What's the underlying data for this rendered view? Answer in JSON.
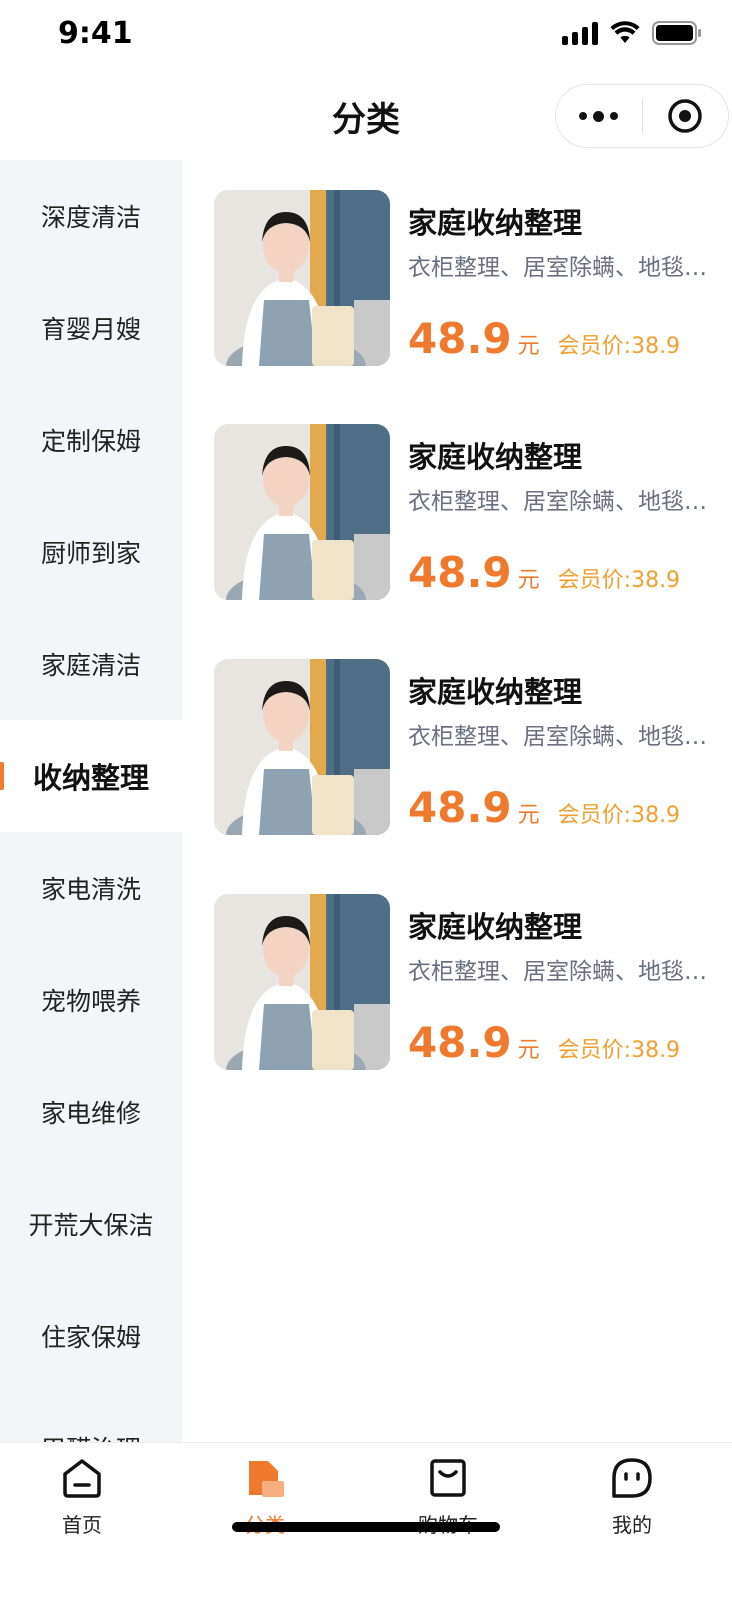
{
  "status_bar": {
    "time": "9:41"
  },
  "nav": {
    "title": "分类"
  },
  "sidebar": {
    "items": [
      {
        "label": "深度清洁"
      },
      {
        "label": "育婴月嫂"
      },
      {
        "label": "定制保姆"
      },
      {
        "label": "厨师到家"
      },
      {
        "label": "家庭清洁"
      },
      {
        "label": "收纳整理",
        "active": true
      },
      {
        "label": "家电清洗"
      },
      {
        "label": "宠物喂养"
      },
      {
        "label": "家电维修"
      },
      {
        "label": "开荒大保洁"
      },
      {
        "label": "住家保姆"
      },
      {
        "label": "甲醛治理"
      }
    ]
  },
  "products": [
    {
      "title": "家庭收纳整理",
      "desc": "衣柜整理、居室除螨、地毯清洗",
      "price": "48.9",
      "unit": "元",
      "member_price": "会员价:38.9"
    },
    {
      "title": "家庭收纳整理",
      "desc": "衣柜整理、居室除螨、地毯清洗",
      "price": "48.9",
      "unit": "元",
      "member_price": "会员价:38.9"
    },
    {
      "title": "家庭收纳整理",
      "desc": "衣柜整理、居室除螨、地毯清洗",
      "price": "48.9",
      "unit": "元",
      "member_price": "会员价:38.9"
    },
    {
      "title": "家庭收纳整理",
      "desc": "衣柜整理、居室除螨、地毯清洗",
      "price": "48.9",
      "unit": "元",
      "member_price": "会员价:38.9"
    }
  ],
  "tabs": [
    {
      "label": "首页",
      "icon": "home-icon"
    },
    {
      "label": "分类",
      "icon": "category-icon",
      "active": true
    },
    {
      "label": "购物车",
      "icon": "cart-icon"
    },
    {
      "label": "我的",
      "icon": "profile-icon"
    }
  ],
  "colors": {
    "accent": "#ef7a2d",
    "member": "#f39f30",
    "sidebar_bg": "#f4f5f9"
  }
}
